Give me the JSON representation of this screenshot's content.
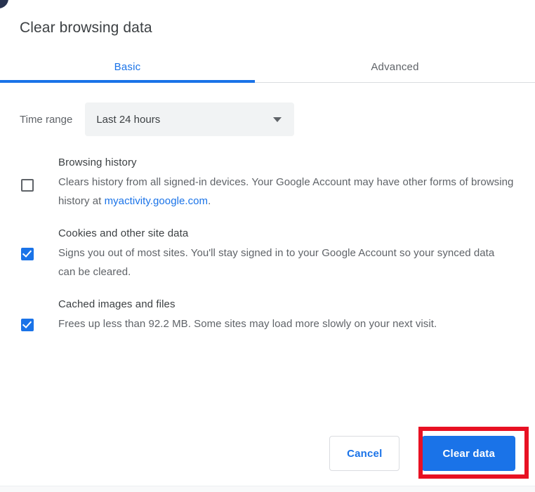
{
  "dialog": {
    "title": "Clear browsing data"
  },
  "tabs": [
    {
      "label": "Basic",
      "selected": true
    },
    {
      "label": "Advanced",
      "selected": false
    }
  ],
  "time_range": {
    "label": "Time range",
    "selected_value": "Last 24 hours",
    "chevron_icon": "chevron-down-icon"
  },
  "options": [
    {
      "title": "Browsing history",
      "desc_before_link": "Clears history from all signed-in devices. Your Google Account may have other forms of browsing history at ",
      "link_text": "myactivity.google.com",
      "desc_after_link": ".",
      "checked": false
    },
    {
      "title": "Cookies and other site data",
      "desc_before_link": "Signs you out of most sites. You'll stay signed in to your Google Account so your synced data can be cleared.",
      "link_text": "",
      "desc_after_link": "",
      "checked": true
    },
    {
      "title": "Cached images and files",
      "desc_before_link": "Frees up less than 92.2 MB. Some sites may load more slowly on your next visit.",
      "link_text": "",
      "desc_after_link": "",
      "checked": true
    }
  ],
  "footer": {
    "cancel_label": "Cancel",
    "clear_label": "Clear data"
  },
  "colors": {
    "accent": "#1a73e8",
    "annotation": "#e81123",
    "text_primary": "#3c4043",
    "text_secondary": "#5f6368",
    "select_background": "#f1f3f4",
    "divider": "#dadce0"
  }
}
